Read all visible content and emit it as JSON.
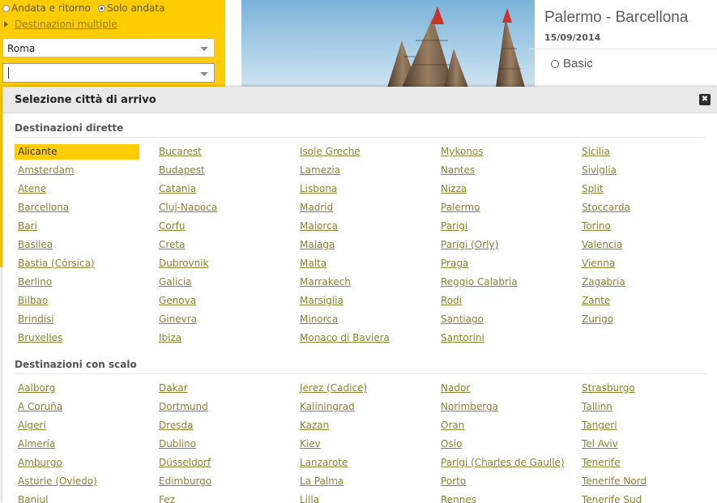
{
  "search": {
    "trip_type_options": [
      {
        "label": "Andata e ritorno",
        "selected": false
      },
      {
        "label": "Solo andata",
        "selected": true
      }
    ],
    "multi_destination_link": "Destinazioni multiple",
    "origin_value": "Roma",
    "destination_value": ""
  },
  "flight_card": {
    "route": "Palermo - Barcellona",
    "date": "15/09/2014",
    "fare_option": "Basic"
  },
  "modal": {
    "title": "Selezione città di arrivo",
    "close_label": "✖",
    "direct_section_title": "Destinazioni dirette",
    "direct_columns": [
      [
        "Alicante",
        "Amsterdam",
        "Atene",
        "Barcellona",
        "Bari",
        "Basilea",
        "Bastia (Córsica)",
        "Berlino",
        "Bilbao",
        "Brindisi",
        "Bruxelles"
      ],
      [
        "Bucarest",
        "Budapest",
        "Catania",
        "Cluj-Napoca",
        "Corfu",
        "Creta",
        "Dubrovnik",
        "Galicia",
        "Genova",
        "Ginevra",
        "Ibiza"
      ],
      [
        "Isole Greche",
        "Lamezia",
        "Lisbona",
        "Madrid",
        "Maiorca",
        "Malaga",
        "Malta",
        "Marrakech",
        "Marsiglia",
        "Minorca",
        "Monaco di Baviera"
      ],
      [
        "Mykonos",
        "Nantes",
        "Nizza",
        "Palermo",
        "Parigi",
        "Parigi (Orly)",
        "Praga",
        "Reggio Calabria",
        "Rodi",
        "Santiago",
        "Santorini"
      ],
      [
        "Sicilia",
        "Siviglia",
        "Split",
        "Stoccarda",
        "Torino",
        "Valencia",
        "Vienna",
        "Zagabria",
        "Zante",
        "Zurigo"
      ]
    ],
    "selected_destination": "Alicante",
    "connecting_section_title": "Destinazioni con scalo",
    "connecting_columns": [
      [
        "Aalborg",
        "A Coruña",
        "Algeri",
        "Almería",
        "Amburgo",
        "Asturie (Oviedo)",
        "Banjul"
      ],
      [
        "Dakar",
        "Dortmund",
        "Dresda",
        "Dublino",
        "Düsseldorf",
        "Edimburgo",
        "Fez"
      ],
      [
        "Jerez (Cadice)",
        "Kaliningrad",
        "Kazan",
        "Kiev",
        "Lanzarote",
        "La Palma",
        "Lilla"
      ],
      [
        "Nador",
        "Norimberga",
        "Oran",
        "Oslo",
        "Parigi (Charles de Gaulle)",
        "Porto",
        "Rennes"
      ],
      [
        "Strasburgo",
        "Tallinn",
        "Tangeri",
        "Tel Aviv",
        "Tenerife",
        "Tenerife Nord",
        "Tenerife Sud"
      ]
    ]
  },
  "colors": {
    "brand_yellow": "#FFCC00",
    "link_olive": "#8A8230",
    "header_gray": "#E9E9E9"
  }
}
